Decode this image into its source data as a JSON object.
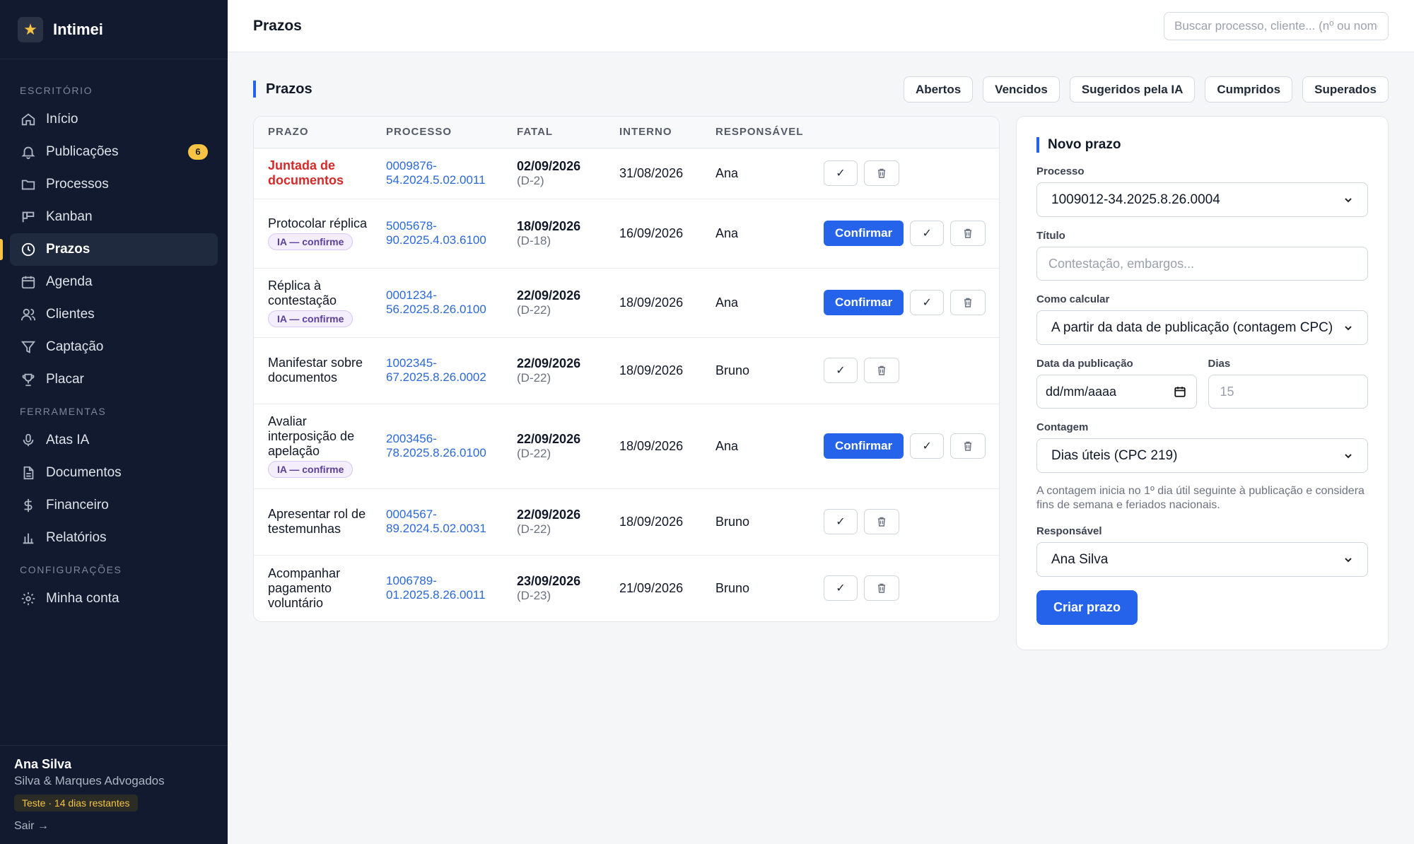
{
  "app": {
    "name": "Intimei"
  },
  "sidebar": {
    "sections": {
      "escritorio": "ESCRITÓRIO",
      "ferramentas": "FERRAMENTAS",
      "configuracoes": "CONFIGURAÇÕES"
    },
    "items": [
      {
        "label": "Início",
        "icon": "home-icon"
      },
      {
        "label": "Publicações",
        "icon": "bell-icon",
        "badge": "6"
      },
      {
        "label": "Processos",
        "icon": "folder-icon"
      },
      {
        "label": "Kanban",
        "icon": "kanban-icon"
      },
      {
        "label": "Prazos",
        "icon": "clock-icon",
        "active": true
      },
      {
        "label": "Agenda",
        "icon": "calendar-icon"
      },
      {
        "label": "Clientes",
        "icon": "users-icon"
      },
      {
        "label": "Captação",
        "icon": "filter-icon"
      },
      {
        "label": "Placar",
        "icon": "trophy-icon"
      },
      {
        "label": "Atas IA",
        "icon": "microphone-icon"
      },
      {
        "label": "Documentos",
        "icon": "document-icon"
      },
      {
        "label": "Financeiro",
        "icon": "dollar-icon"
      },
      {
        "label": "Relatórios",
        "icon": "bar-chart-icon"
      },
      {
        "label": "Minha conta",
        "icon": "gear-icon"
      }
    ],
    "user": {
      "name": "Ana Silva",
      "firm": "Silva & Marques Advogados",
      "trial": "Teste · 14 dias restantes",
      "logout": "Sair →"
    }
  },
  "topbar": {
    "title": "Prazos",
    "search_placeholder": "Buscar processo, cliente... (nº ou nome)"
  },
  "main": {
    "title": "Prazos",
    "filters": [
      "Abertos",
      "Vencidos",
      "Sugeridos pela IA",
      "Cumpridos",
      "Superados"
    ]
  },
  "table": {
    "headers": [
      "PRAZO",
      "PROCESSO",
      "FATAL",
      "INTERNO",
      "RESPONSÁVEL"
    ],
    "confirm_label": "Confirmar",
    "check_label": "✓",
    "rows": [
      {
        "prazo": "Juntada de documentos",
        "overdue": true,
        "ia": "",
        "processo": "0009876-54.2024.5.02.0011",
        "fatal": "02/09/2026",
        "d": "(D-2)",
        "interno": "31/08/2026",
        "responsavel": "Ana"
      },
      {
        "prazo": "Protocolar réplica",
        "overdue": false,
        "ia": "IA — confirme",
        "processo": "5005678-90.2025.4.03.6100",
        "fatal": "18/09/2026",
        "d": "(D-18)",
        "interno": "16/09/2026",
        "responsavel": "Ana"
      },
      {
        "prazo": "Réplica à contestação",
        "overdue": false,
        "ia": "IA — confirme",
        "processo": "0001234-56.2025.8.26.0100",
        "fatal": "22/09/2026",
        "d": "(D-22)",
        "interno": "18/09/2026",
        "responsavel": "Ana"
      },
      {
        "prazo": "Manifestar sobre documentos",
        "overdue": false,
        "ia": "",
        "processo": "1002345-67.2025.8.26.0002",
        "fatal": "22/09/2026",
        "d": "(D-22)",
        "interno": "18/09/2026",
        "responsavel": "Bruno"
      },
      {
        "prazo": "Avaliar interposição de apelação",
        "overdue": false,
        "ia": "IA — confirme",
        "processo": "2003456-78.2025.8.26.0100",
        "fatal": "22/09/2026",
        "d": "(D-22)",
        "interno": "18/09/2026",
        "responsavel": "Ana"
      },
      {
        "prazo": "Apresentar rol de testemunhas",
        "overdue": false,
        "ia": "",
        "processo": "0004567-89.2024.5.02.0031",
        "fatal": "22/09/2026",
        "d": "(D-22)",
        "interno": "18/09/2026",
        "responsavel": "Bruno"
      },
      {
        "prazo": "Acompanhar pagamento voluntário",
        "overdue": false,
        "ia": "",
        "processo": "1006789-01.2025.8.26.0011",
        "fatal": "23/09/2026",
        "d": "(D-23)",
        "interno": "21/09/2026",
        "responsavel": "Bruno"
      }
    ]
  },
  "form": {
    "title": "Novo prazo",
    "processo_label": "Processo",
    "processo_value": "1009012-34.2025.8.26.0004",
    "titulo_label": "Título",
    "titulo_placeholder": "Contestação, embargos...",
    "calc_label": "Como calcular",
    "calc_value": "A partir da data de publicação (contagem CPC)",
    "data_label": "Data da publicação",
    "data_placeholder": "dd/mm/aaaa",
    "dias_label": "Dias",
    "dias_placeholder": "15",
    "contagem_label": "Contagem",
    "contagem_value": "Dias úteis (CPC 219)",
    "help": "A contagem inicia no 1º dia útil seguinte à publicação e considera fins de semana e feriados nacionais.",
    "resp_label": "Responsável",
    "resp_value": "Ana Silva",
    "submit_label": "Criar prazo"
  },
  "colors": {
    "sidebar_bg": "#111a2e",
    "accent": "#2563eb",
    "badge": "#f6c344",
    "overdue": "#d42a2a"
  }
}
